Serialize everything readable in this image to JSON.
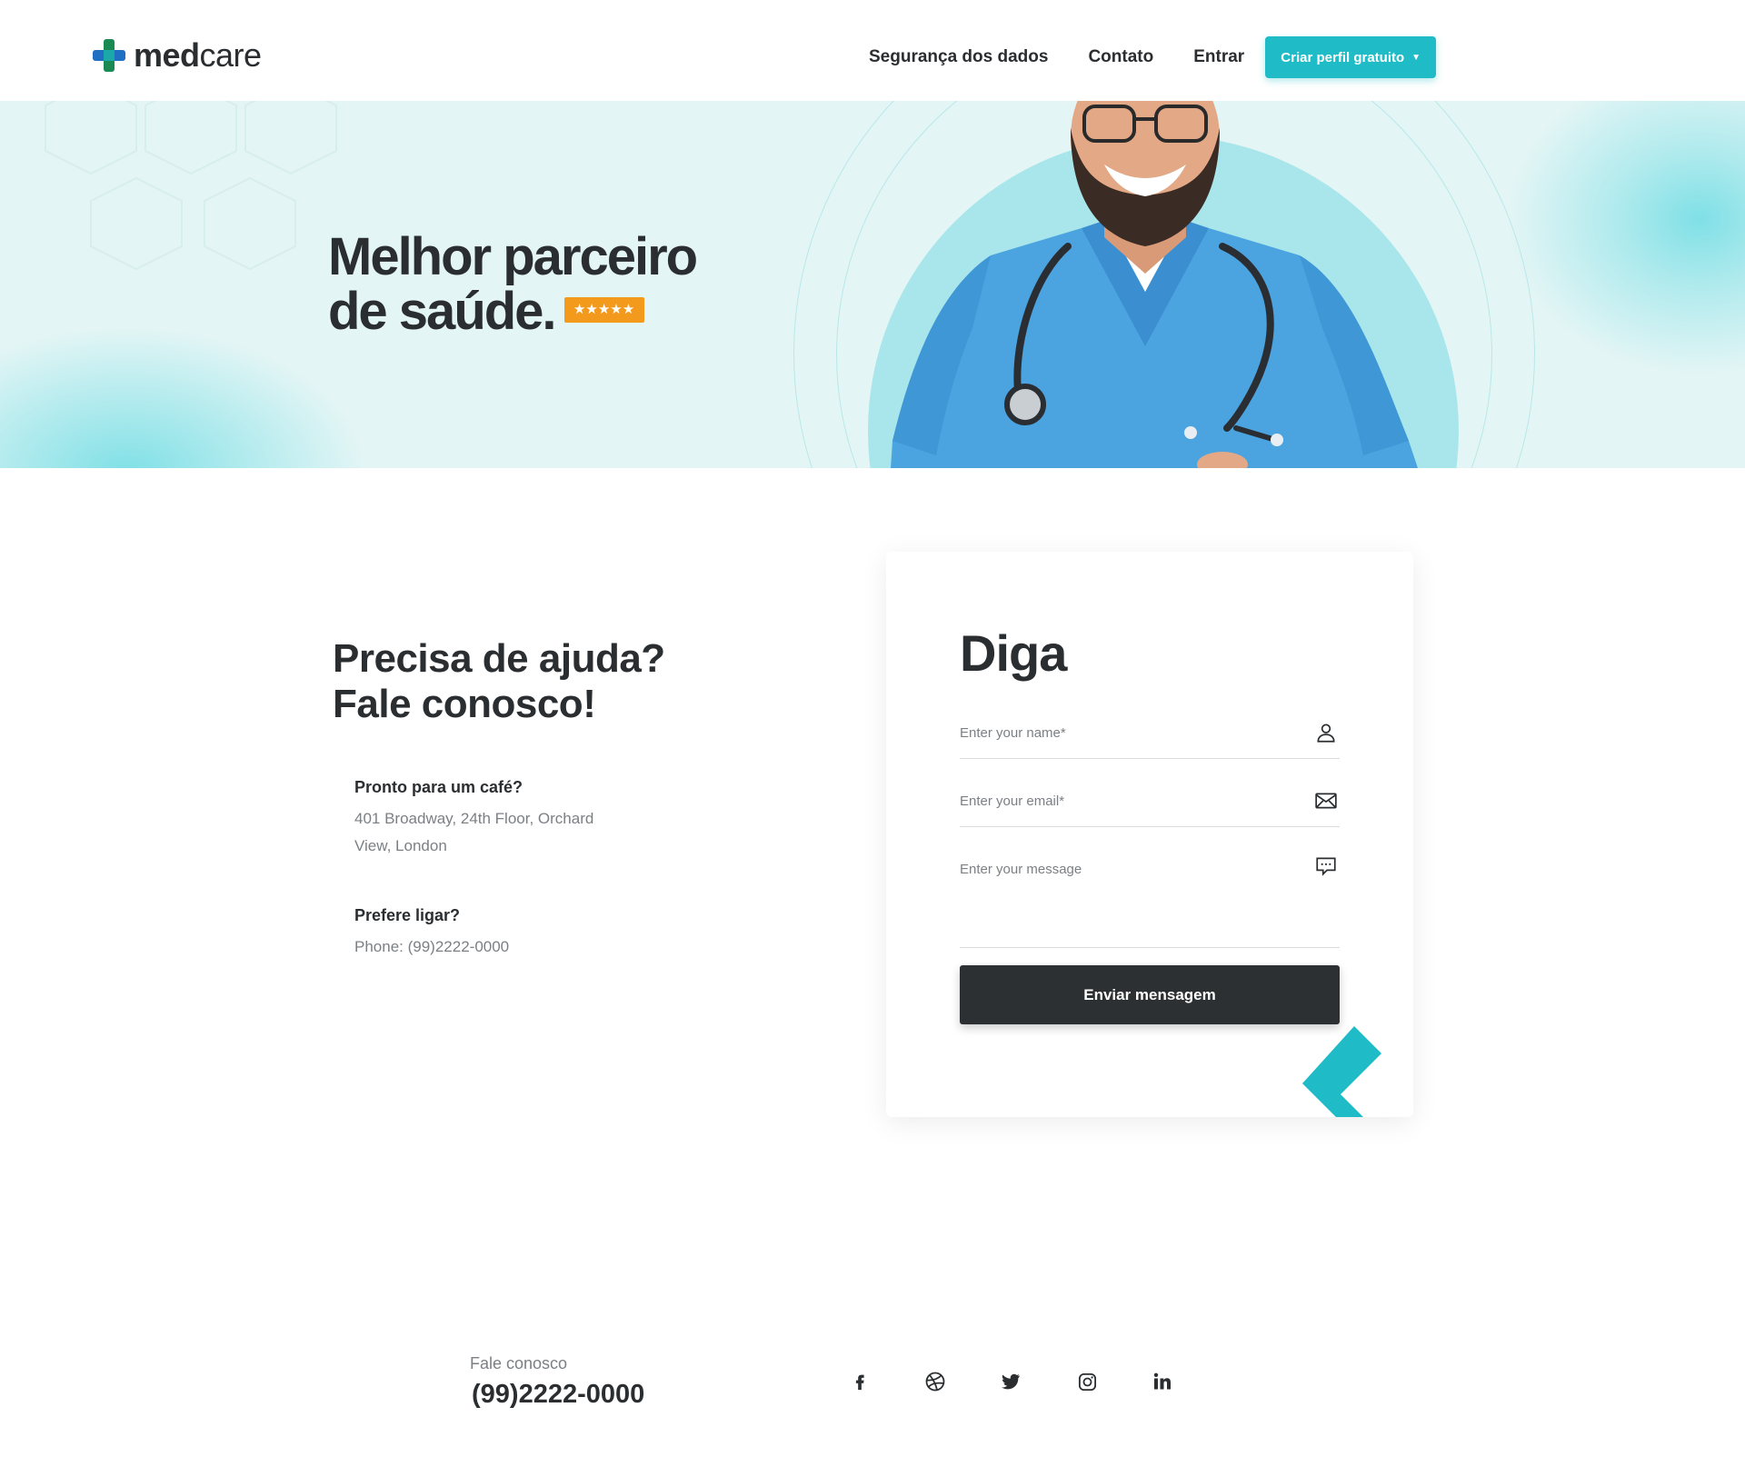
{
  "brand": {
    "name_bold": "med",
    "name_rest": "care"
  },
  "nav": {
    "items": [
      "Segurança dos dados",
      "Contato",
      "Entrar"
    ],
    "cta_label": "Criar perfil gratuito",
    "cta_color": "#1fbcc7"
  },
  "hero": {
    "title_line1": "Melhor parceiro",
    "title_line2": "de saúde.",
    "rating_stars": "★★★★★",
    "rating_color": "#f39a1c",
    "background_color": "#e3f5f5"
  },
  "contact": {
    "title_line1": "Precisa de ajuda?",
    "title_line2": "Fale conosco!",
    "address_label": "Pronto para um café?",
    "address_line1": "401 Broadway, 24th Floor, Orchard",
    "address_line2": "View, London",
    "phone_label": "Prefere ligar?",
    "phone_text": "Phone: (99)2222-0000"
  },
  "form": {
    "title": "Diga",
    "name_placeholder": "Enter your name*",
    "email_placeholder": "Enter your email*",
    "message_placeholder": "Enter your message",
    "submit_label": "Enviar mensagem",
    "icons": [
      "user-icon",
      "envelope-icon",
      "chat-icon"
    ]
  },
  "footer": {
    "label": "Fale conosco",
    "phone": "(99)2222-0000",
    "social": [
      "facebook-icon",
      "dribbble-icon",
      "twitter-icon",
      "instagram-icon",
      "linkedin-icon"
    ]
  }
}
